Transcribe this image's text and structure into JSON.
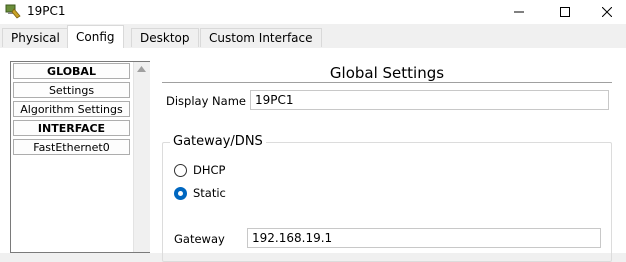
{
  "window": {
    "title": "19PC1",
    "icon": "pc-icon"
  },
  "tabs": [
    {
      "label": "Physical",
      "active": false
    },
    {
      "label": "Config",
      "active": true
    },
    {
      "label": "Desktop",
      "active": false
    },
    {
      "label": "Custom Interface",
      "active": false
    }
  ],
  "nav": {
    "items": [
      {
        "label": "GLOBAL",
        "header": true
      },
      {
        "label": "Settings",
        "header": false
      },
      {
        "label": "Algorithm Settings",
        "header": false
      },
      {
        "label": "INTERFACE",
        "header": true
      },
      {
        "label": "FastEthernet0",
        "header": false
      }
    ]
  },
  "main": {
    "title": "Global Settings",
    "display_name_label": "Display Name",
    "display_name_value": "19PC1",
    "gateway_group_label": "Gateway/DNS",
    "dhcp_label": "DHCP",
    "static_label": "Static",
    "selected_mode": "Static",
    "gateway_label": "Gateway",
    "gateway_value": "192.168.19.1"
  },
  "colors": {
    "accent": "#0067c0",
    "window_bg": "#f0f0f0",
    "content_bg": "#ffffff"
  }
}
